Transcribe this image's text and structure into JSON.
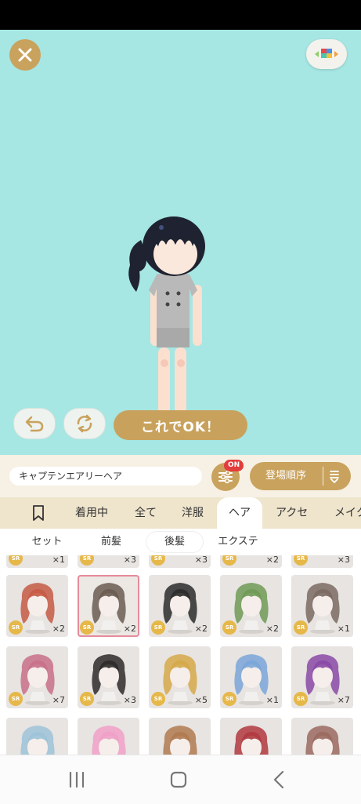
{
  "header": {
    "close_icon": "close-icon",
    "view_icon": "view-toggle-icon"
  },
  "stage": {
    "background": "#a6e6e3",
    "ok_label": "これでOK！",
    "undo_icon": "undo-icon",
    "rotate_icon": "rotate-icon"
  },
  "info": {
    "item_name": "キャプテンエアリーヘア",
    "filter_badge": "ON",
    "sort_label": "登場順序"
  },
  "tabs": [
    "着用中",
    "全て",
    "洋服",
    "ヘア",
    "アクセ",
    "メイク"
  ],
  "active_tab": "ヘア",
  "subtabs": [
    "セット",
    "前髪",
    "後髪",
    "エクステ"
  ],
  "active_subtab": "後髪",
  "rarity_label": "SR",
  "items_top_counts": [
    "×1",
    "×3",
    "×3",
    "×2",
    "×3"
  ],
  "items": [
    {
      "count": "×2",
      "hair": "#c65a45"
    },
    {
      "count": "×2",
      "hair": "#6b5c52"
    },
    {
      "count": "×2",
      "hair": "#2b2b2b"
    },
    {
      "count": "×2",
      "hair": "#6f9a55"
    },
    {
      "count": "×1",
      "hair": "#7a6a62"
    },
    {
      "count": "×7",
      "hair": "#c87089"
    },
    {
      "count": "×3",
      "hair": "#2e2a2a"
    },
    {
      "count": "×5",
      "hair": "#d5a94a"
    },
    {
      "count": "×1",
      "hair": "#7aa6d8"
    },
    {
      "count": "×7",
      "hair": "#8a4aa6"
    }
  ],
  "items_bottom_hair": [
    "#9dc3d8",
    "#f0a0c8",
    "#b07a50",
    "#b03a40",
    "#9a6a60"
  ],
  "nav": {
    "recent_icon": "recent-apps-icon",
    "home_icon": "home-icon",
    "back_icon": "back-icon"
  }
}
